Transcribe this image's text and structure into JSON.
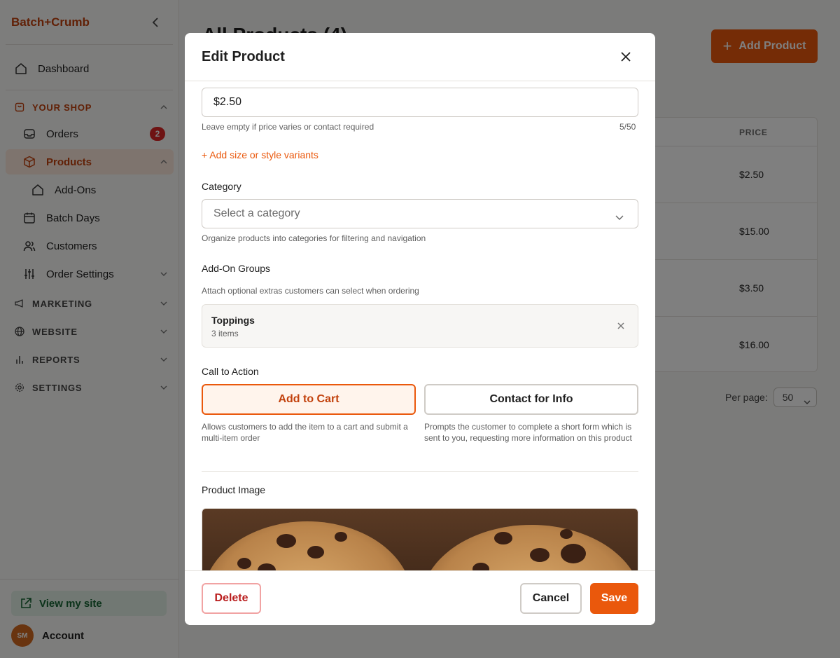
{
  "sidebar": {
    "brand": "Batch+Crumb",
    "dashboard": "Dashboard",
    "your_shop": "YOUR SHOP",
    "orders": "Orders",
    "orders_badge": "2",
    "products": "Products",
    "add_ons": "Add-Ons",
    "batch_days": "Batch Days",
    "customers": "Customers",
    "order_settings": "Order Settings",
    "marketing": "MARKETING",
    "website": "WEBSITE",
    "reports": "REPORTS",
    "settings": "SETTINGS",
    "view_site": "View my site",
    "avatar_initials": "SM",
    "account": "Account"
  },
  "main": {
    "title": "All Products (4)",
    "add_product": "Add Product",
    "table": {
      "price_header": "PRICE",
      "prices": [
        "$2.50",
        "$15.00",
        "$3.50",
        "$16.00"
      ]
    },
    "per_page_label": "Per page:",
    "per_page_value": "50"
  },
  "modal": {
    "title": "Edit Product",
    "price_value": "$2.50",
    "price_hint": "Leave empty if price varies or contact required",
    "price_count": "5/50",
    "variants_link": "+ Add size or style variants",
    "category_label": "Category",
    "category_placeholder": "Select a category",
    "category_hint": "Organize products into categories for filtering and navigation",
    "addon_groups_label": "Add-On Groups",
    "addon_groups_hint": "Attach optional extras customers can select when ordering",
    "addon_group": {
      "name": "Toppings",
      "count": "3 items"
    },
    "cta_label": "Call to Action",
    "cta_add_to_cart": "Add to Cart",
    "cta_add_to_cart_hint": "Allows customers to add the item to a cart and submit a multi-item order",
    "cta_contact": "Contact for Info",
    "cta_contact_hint": "Prompts the customer to complete a short form which is sent to you, requesting more information on this product",
    "image_label": "Product Image",
    "delete": "Delete",
    "cancel": "Cancel",
    "save": "Save"
  },
  "colors": {
    "accent": "#ea580c",
    "accent_dark": "#c2410c",
    "danger": "#b91c1c",
    "success": "#166534"
  }
}
